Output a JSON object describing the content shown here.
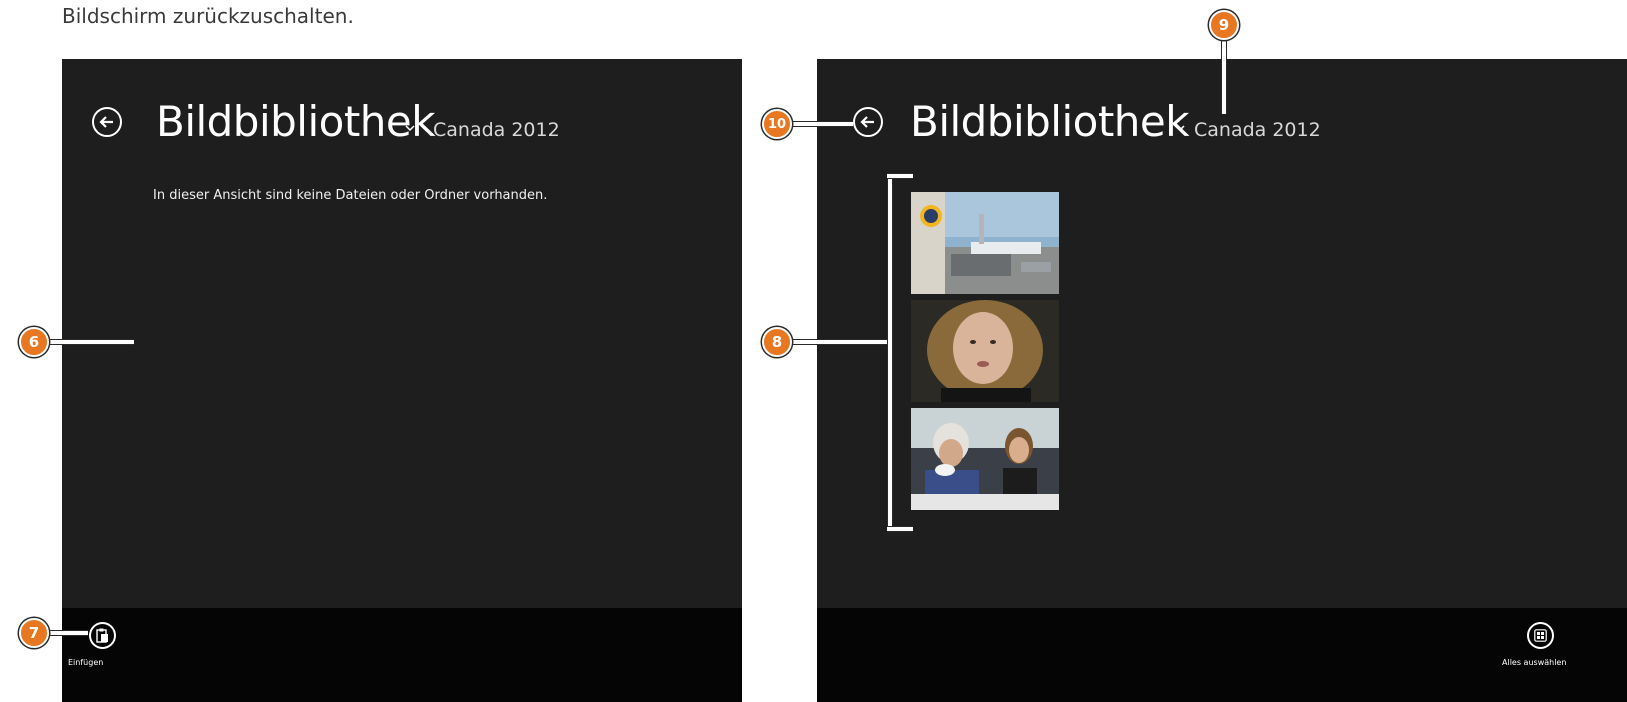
{
  "caption": "Bildschirm zurückzuschalten.",
  "left_screen": {
    "title": "Bildbibliothek",
    "subtitle": "Canada 2012",
    "empty_message": "In dieser Ansicht sind keine Dateien oder Ordner vorhanden.",
    "appbar": {
      "paste_label": "Einfügen"
    }
  },
  "right_screen": {
    "title": "Bildbibliothek",
    "subtitle": "Canada 2012",
    "thumbnails": [
      "airport-photo",
      "portrait-photo",
      "cafe-photo"
    ],
    "appbar": {
      "select_all_label": "Alles auswählen"
    }
  },
  "callouts": {
    "c6": "6",
    "c7": "7",
    "c8": "8",
    "c9": "9",
    "c10": "10"
  },
  "icons": {
    "back": "back-arrow-icon",
    "dropdown": "chevron-down-icon",
    "paste": "clipboard-paste-icon",
    "select_all": "select-all-icon"
  },
  "colors": {
    "callout": "#e87722",
    "screen_bg": "#1e1e1e",
    "appbar_bg": "#050505"
  }
}
